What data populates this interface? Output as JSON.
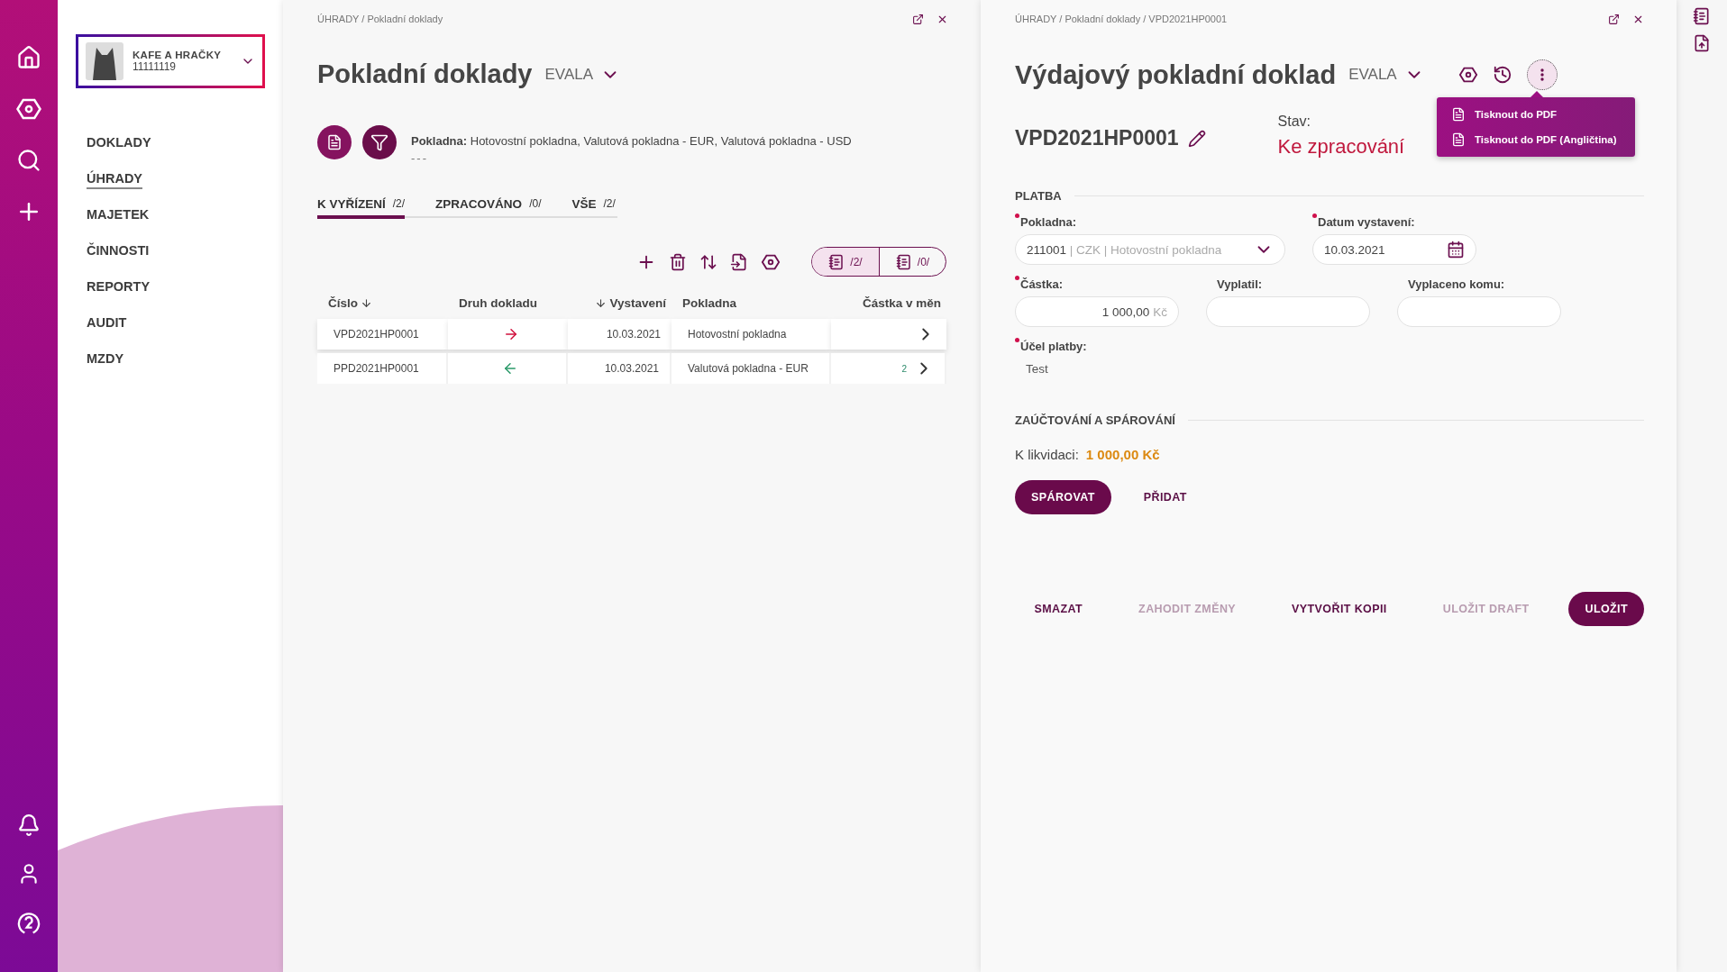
{
  "company": {
    "name": "KAFE A HRAČKY",
    "id": "11111119"
  },
  "nav": [
    {
      "label": "DOKLADY",
      "selected": false
    },
    {
      "label": "ÚHRADY",
      "selected": true
    },
    {
      "label": "MAJETEK",
      "selected": false
    },
    {
      "label": "ČINNOSTI",
      "selected": false
    },
    {
      "label": "REPORTY",
      "selected": false
    },
    {
      "label": "AUDIT",
      "selected": false
    },
    {
      "label": "MZDY",
      "selected": false
    }
  ],
  "list_panel": {
    "breadcrumb": "ÚHRADY / Pokladní doklady",
    "title": "Pokladní doklady",
    "org": "EVALA",
    "filter": {
      "label": "Pokladna:",
      "value": "Hotovostní pokladna, Valutová pokladna - EUR, Valutová pokladna - USD",
      "extra": "---"
    },
    "tabs": [
      {
        "label": "K VYŘÍZENÍ",
        "count": "/2/",
        "selected": true
      },
      {
        "label": "ZPRACOVÁNO",
        "count": "/0/",
        "selected": false
      },
      {
        "label": "VŠE",
        "count": "/2/",
        "selected": false
      }
    ],
    "view_toggle": [
      {
        "count": "/2/",
        "selected": true
      },
      {
        "count": "/0/",
        "selected": false
      }
    ],
    "columns": [
      "Číslo",
      "Druh dokladu",
      "Vystavení",
      "Pokladna",
      "Částka v měn"
    ],
    "rows": [
      {
        "number": "VPD2021HP0001",
        "outgoing": true,
        "date": "10.03.2021",
        "register": "Hotovostní pokladna",
        "selected": true
      },
      {
        "number": "PPD2021HP0001",
        "outgoing": false,
        "date": "10.03.2021",
        "register": "Valutová pokladna - EUR",
        "amount": "2",
        "selected": false
      }
    ]
  },
  "detail": {
    "breadcrumb": "ÚHRADY / Pokladní doklady / VPD2021HP0001",
    "title": "Výdajový pokladní doklad",
    "org": "EVALA",
    "menu": [
      "Tisknout do PDF",
      "Tisknout do PDF (Angličtina)"
    ],
    "number": "VPD2021HP0001",
    "status_label": "Stav:",
    "status": "Ke zpracování",
    "section_payment": "PLATBA",
    "fields": [
      {
        "kind": "select",
        "label": "Pokladna:",
        "required": true,
        "value": "211001",
        "extra": "| CZK | Hotovostní pokladna"
      },
      {
        "kind": "date",
        "label": "Datum vystavení:",
        "required": true,
        "value": "10.03.2021"
      },
      {
        "kind": "amount",
        "label": "Částka:",
        "required": true,
        "value": "1 000,00",
        "unit": "Kč"
      },
      {
        "kind": "text",
        "label": "Vyplatil:",
        "required": false
      },
      {
        "kind": "text",
        "label": "Vyplaceno komu:",
        "required": false
      },
      {
        "kind": "static",
        "label": "Účel platby:",
        "required": true,
        "value": "Test"
      }
    ],
    "section_booking": "ZAÚČTOVÁNÍ A SPÁROVÁNÍ",
    "balance": {
      "label": "K likvidaci:",
      "value": "1 000,00 Kč"
    },
    "actions": [
      {
        "label": "SPÁROVAT",
        "kind": "primary",
        "disabled": false
      },
      {
        "label": "PŘIDAT",
        "kind": "text",
        "disabled": false
      }
    ],
    "footer": [
      {
        "label": "SMAZAT",
        "kind": "text",
        "disabled": false
      },
      {
        "label": "ZAHODIT ZMĚNY",
        "kind": "text",
        "disabled": true
      },
      {
        "label": "VYTVOŘIT KOPII",
        "kind": "text",
        "disabled": false
      },
      {
        "label": "ULOŽIT DRAFT",
        "kind": "text",
        "disabled": true
      },
      {
        "label": "ULOŽIT",
        "kind": "primary",
        "disabled": false
      }
    ]
  }
}
